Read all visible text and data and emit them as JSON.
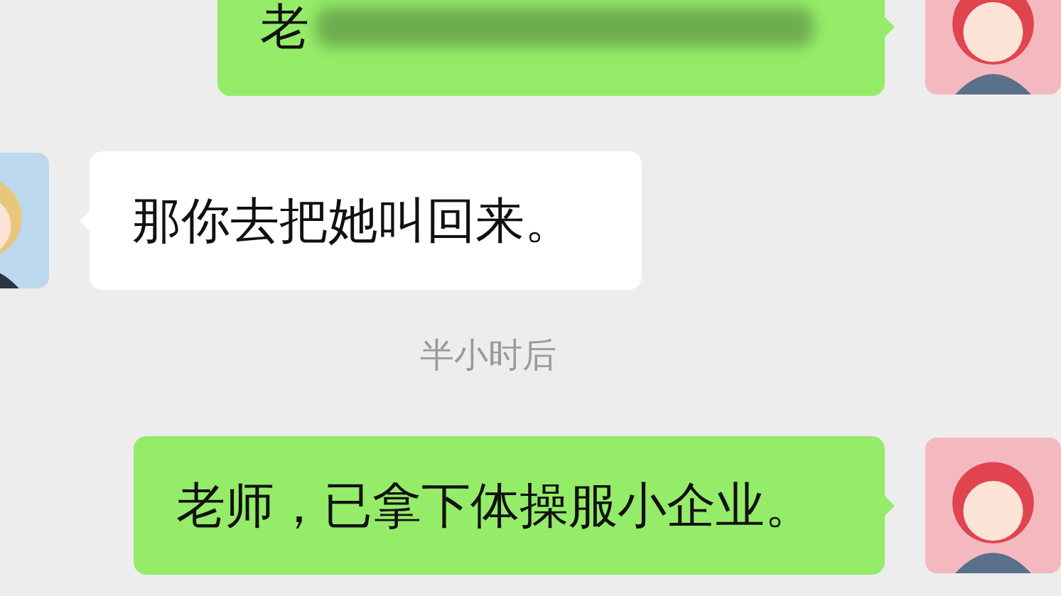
{
  "messages": [
    {
      "kind": "outgoing",
      "text": "老",
      "blurred": true
    },
    {
      "kind": "incoming",
      "text": "那你去把她叫回来。",
      "blurred": false
    },
    {
      "kind": "time",
      "text": "半小时后"
    },
    {
      "kind": "outgoing",
      "text": "老师，已拿下体操服小企业。",
      "blurred": false
    }
  ]
}
